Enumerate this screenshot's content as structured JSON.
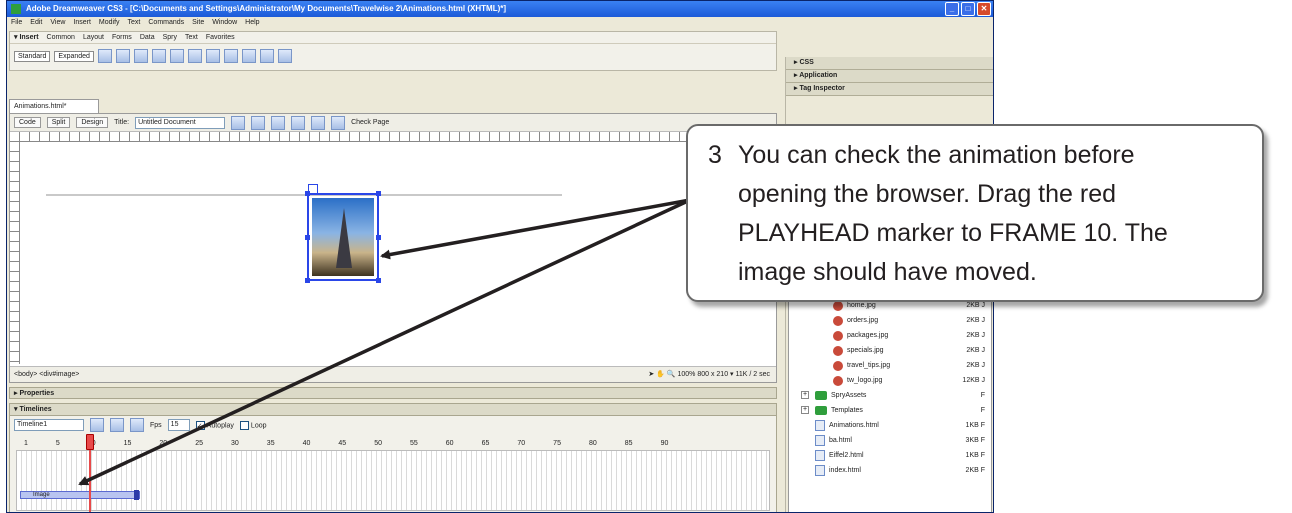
{
  "window": {
    "title": "Adobe Dreamweaver CS3 - [C:\\Documents and Settings\\Administrator\\My Documents\\Travelwise 2\\Animations.html (XHTML)*]"
  },
  "menubar": [
    "File",
    "Edit",
    "View",
    "Insert",
    "Modify",
    "Text",
    "Commands",
    "Site",
    "Window",
    "Help"
  ],
  "insertbar": {
    "header": "▾ Insert",
    "tabs": [
      "Common",
      "Layout",
      "Forms",
      "Data",
      "Spry",
      "Text",
      "Favorites"
    ],
    "standard": "Standard",
    "expanded": "Expanded"
  },
  "document": {
    "tab": "Animations.html*",
    "code": "Code",
    "split": "Split",
    "design": "Design",
    "title_label": "Title:",
    "title_value": "Untitled Document",
    "check_page": "Check Page",
    "tag_path": "<body> <div#image>",
    "zoom": "100%",
    "size_info": "800 x 210 ▾ 11K / 2 sec"
  },
  "properties": {
    "label": "▸ Properties"
  },
  "timelines": {
    "label": "▾ Timelines",
    "timeline_name": "Timeline1",
    "fps_label": "Fps",
    "fps": "15",
    "autoplay": "Autoplay",
    "loop": "Loop",
    "frame_numbers": [
      "1",
      "5",
      "10",
      "15",
      "20",
      "25",
      "30",
      "35",
      "40",
      "45",
      "50",
      "55",
      "60",
      "65",
      "70",
      "75",
      "80",
      "85",
      "90"
    ],
    "track_label": "Image"
  },
  "side_panels": [
    "▸ CSS",
    "▸ Application",
    "▸ Tag Inspector"
  ],
  "files": [
    {
      "name": "home.jpg",
      "size": "2KB J",
      "kind": "image"
    },
    {
      "name": "orders.jpg",
      "size": "2KB J",
      "kind": "image"
    },
    {
      "name": "packages.jpg",
      "size": "2KB J",
      "kind": "image"
    },
    {
      "name": "specials.jpg",
      "size": "2KB J",
      "kind": "image"
    },
    {
      "name": "travel_tips.jpg",
      "size": "2KB J",
      "kind": "image"
    },
    {
      "name": "tw_logo.jpg",
      "size": "12KB J",
      "kind": "image"
    },
    {
      "name": "SpryAssets",
      "size": "F",
      "kind": "folder"
    },
    {
      "name": "Templates",
      "size": "F",
      "kind": "folder"
    },
    {
      "name": "Animations.html",
      "size": "1KB F",
      "kind": "doc"
    },
    {
      "name": "ba.html",
      "size": "3KB F",
      "kind": "doc"
    },
    {
      "name": "Eiffel2.html",
      "size": "1KB F",
      "kind": "doc"
    },
    {
      "name": "index.html",
      "size": "2KB F",
      "kind": "doc"
    }
  ],
  "callout": {
    "number": "3",
    "lines": [
      "You can check the animation before",
      "opening the browser.  Drag the red",
      "PLAYHEAD marker to FRAME 10.  The",
      "image should have moved."
    ]
  }
}
